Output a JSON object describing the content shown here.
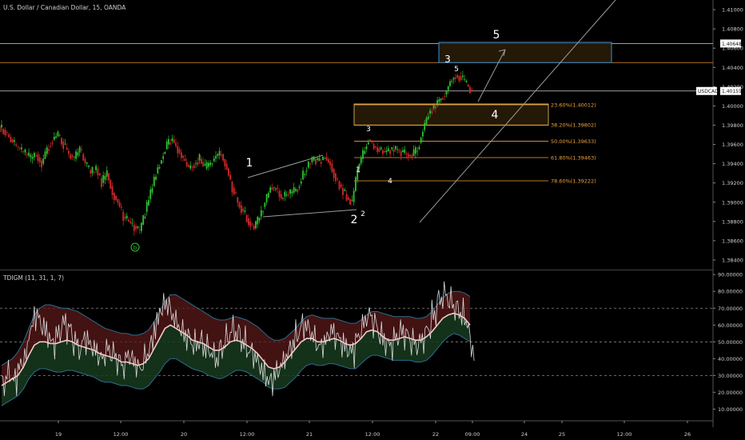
{
  "chart_data": [
    {
      "type": "candlestick",
      "title": "U.S. Dollar / Canadian Dollar, 15, OANDA",
      "symbol": "USDCAD",
      "y_axis_ticks": [
        "1.41000",
        "1.40800",
        "1.40600",
        "1.40400",
        "1.40200",
        "1.40000",
        "1.39800",
        "1.39600",
        "1.39400",
        "1.39200",
        "1.39000",
        "1.38800",
        "1.38600",
        "1.38400"
      ],
      "ylim": [
        1.383,
        1.411
      ],
      "x_axis_ticks": [
        "19",
        "12:00",
        "20",
        "12:00",
        "21",
        "12:00",
        "22",
        "09:00",
        "24",
        "25",
        "12:00",
        "26"
      ],
      "price_labels": [
        {
          "label": "1.40648",
          "value": 1.40648,
          "color": "#ffffff"
        },
        {
          "label": "USDCAD",
          "value": 1.40155,
          "color": "#ffffff"
        },
        {
          "label": "1.40155",
          "value": 1.40155,
          "color": "#ffffff"
        }
      ],
      "close_series": [
        1.3975,
        1.3968,
        1.396,
        1.3955,
        1.395,
        1.3945,
        1.395,
        1.394,
        1.3955,
        1.3965,
        1.397,
        1.396,
        1.395,
        1.3945,
        1.3955,
        1.394,
        1.393,
        1.3935,
        1.392,
        1.393,
        1.391,
        1.39,
        1.3885,
        1.388,
        1.3875,
        1.387,
        1.389,
        1.391,
        1.393,
        1.3945,
        1.396,
        1.3965,
        1.3955,
        1.3945,
        1.3935,
        1.394,
        1.3945,
        1.3935,
        1.394,
        1.3948,
        1.395,
        1.3935,
        1.3915,
        1.39,
        1.389,
        1.388,
        1.3873,
        1.3885,
        1.39,
        1.3915,
        1.3915,
        1.3905,
        1.3908,
        1.391,
        1.3915,
        1.3928,
        1.394,
        1.3945,
        1.3942,
        1.3947,
        1.394,
        1.3925,
        1.3915,
        1.3905,
        1.39,
        1.3935,
        1.395,
        1.3965,
        1.3958,
        1.3955,
        1.3952,
        1.3955,
        1.3955,
        1.3952,
        1.395,
        1.3948,
        1.3955,
        1.3975,
        1.3992,
        1.4,
        1.4006,
        1.4012,
        1.4025,
        1.4032,
        1.403,
        1.4022,
        1.4015
      ],
      "fib_levels": [
        {
          "label": "23.60%(1.40012)",
          "value": 1.40012
        },
        {
          "label": "38.20%(1.39802)",
          "value": 1.39802
        },
        {
          "label": "50.00%(1.39633)",
          "value": 1.39633
        },
        {
          "label": "61.80%(1.39463)",
          "value": 1.39463
        },
        {
          "label": "78.60%(1.39222)",
          "value": 1.39222
        }
      ],
      "horizontal_lines": [
        {
          "value": 1.40648,
          "color": "#d0d0d0"
        },
        {
          "value": 1.4045,
          "color": "#e8902a"
        },
        {
          "value": 1.40155,
          "color": "#d0d0d0"
        }
      ],
      "zones": [
        {
          "from": 1.4045,
          "to": 1.4066,
          "border": "#3d8fd4"
        },
        {
          "from": 1.398,
          "to": 1.4002,
          "border": "#c9a050"
        }
      ],
      "wave_labels": [
        "1",
        "2",
        "1",
        "2",
        "3",
        "4",
        "3",
        "5",
        "4",
        "5"
      ],
      "circle_label": "b",
      "colors": {
        "up": "#31c232",
        "down": "#d12a2a",
        "background": "#000000",
        "fib": "#f0a33c"
      }
    },
    {
      "type": "line",
      "title": "TDIGM (11, 31, 1, 7)",
      "y_axis_ticks": [
        "90.00000",
        "80.00000",
        "70.00000",
        "60.00000",
        "50.00000",
        "40.00000",
        "30.00000",
        "20.00000",
        "10.00000"
      ],
      "ylim": [
        4,
        92
      ],
      "reference_lines": [
        70,
        50,
        30
      ],
      "series": [
        {
          "values": [
            26,
            31,
            27,
            35,
            42,
            58,
            66,
            60,
            55,
            49,
            54,
            61,
            58,
            50,
            46,
            52,
            48,
            44,
            40,
            45,
            43,
            39,
            36,
            42,
            38,
            34,
            40,
            48,
            60,
            70,
            73,
            66,
            60,
            55,
            52,
            48,
            50,
            47,
            44,
            40,
            46,
            52,
            57,
            55,
            50,
            45,
            42,
            36,
            30,
            26,
            31,
            36,
            42,
            48,
            55,
            60,
            58,
            52,
            47,
            50,
            56,
            54,
            50,
            46,
            44,
            52,
            60,
            66,
            62,
            55,
            50,
            48,
            52,
            56,
            54,
            50,
            48,
            52,
            58,
            66,
            75,
            78,
            74,
            70,
            67,
            62,
            46
          ]
        },
        {
          "values": [
            24,
            26,
            28,
            30,
            35,
            42,
            48,
            50,
            50,
            49,
            49,
            50,
            51,
            50,
            48,
            47,
            46,
            45,
            43,
            42,
            41,
            40,
            38,
            38,
            37,
            36,
            37,
            40,
            46,
            52,
            58,
            60,
            58,
            56,
            54,
            51,
            50,
            49,
            47,
            45,
            45,
            47,
            50,
            51,
            50,
            48,
            46,
            43,
            39,
            35,
            34,
            35,
            38,
            42,
            46,
            50,
            52,
            52,
            50,
            50,
            51,
            52,
            51,
            49,
            48,
            49,
            52,
            56,
            57,
            56,
            53,
            51,
            51,
            52,
            53,
            52,
            51,
            51,
            53,
            56,
            60,
            64,
            66,
            67,
            66,
            64,
            60
          ]
        },
        {
          "values": [
            36,
            38,
            40,
            44,
            50,
            58,
            66,
            70,
            72,
            72,
            71,
            70,
            70,
            69,
            68,
            66,
            64,
            62,
            60,
            58,
            57,
            56,
            55,
            55,
            54,
            54,
            55,
            57,
            62,
            68,
            74,
            78,
            78,
            76,
            74,
            72,
            70,
            68,
            66,
            64,
            63,
            63,
            64,
            65,
            64,
            63,
            61,
            59,
            56,
            53,
            51,
            51,
            52,
            55,
            58,
            62,
            65,
            66,
            65,
            64,
            64,
            64,
            63,
            62,
            61,
            61,
            63,
            66,
            68,
            68,
            67,
            66,
            65,
            65,
            65,
            65,
            64,
            64,
            65,
            68,
            72,
            76,
            79,
            80,
            80,
            79,
            77
          ]
        },
        {
          "values": [
            12,
            14,
            16,
            18,
            22,
            28,
            32,
            34,
            34,
            33,
            32,
            32,
            33,
            33,
            32,
            31,
            30,
            29,
            27,
            26,
            26,
            25,
            24,
            24,
            23,
            22,
            22,
            24,
            28,
            32,
            37,
            40,
            40,
            38,
            36,
            34,
            33,
            32,
            30,
            29,
            28,
            29,
            31,
            33,
            33,
            32,
            30,
            28,
            26,
            23,
            22,
            22,
            23,
            26,
            29,
            33,
            36,
            37,
            36,
            36,
            37,
            37,
            36,
            35,
            34,
            34,
            37,
            40,
            42,
            42,
            41,
            40,
            39,
            39,
            39,
            39,
            38,
            38,
            39,
            42,
            46,
            50,
            53,
            55,
            54,
            52,
            50
          ]
        }
      ],
      "colors": {
        "rsi": "#d9d9d9",
        "signal": "#ffffff",
        "upper_band": "#2a6e8c",
        "lower_band": "#2a6e8c",
        "upper_fill": "#5a1818",
        "lower_fill": "#173a1e"
      }
    }
  ]
}
